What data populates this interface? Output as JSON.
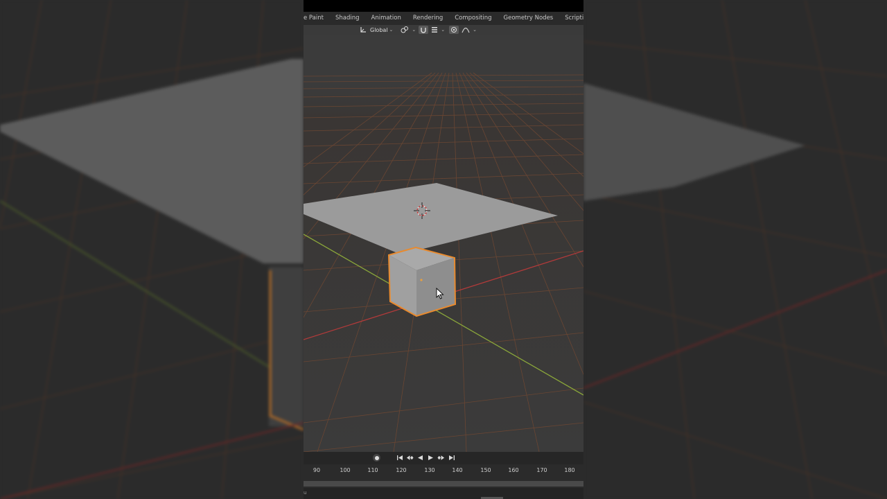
{
  "workspace_tabs": [
    {
      "label": "e Paint"
    },
    {
      "label": "Shading"
    },
    {
      "label": "Animation"
    },
    {
      "label": "Rendering"
    },
    {
      "label": "Compositing"
    },
    {
      "label": "Geometry Nodes"
    },
    {
      "label": "Scripting"
    }
  ],
  "add_tab_label": "+",
  "header": {
    "transform_orientation": "Global",
    "chevron": "⌄"
  },
  "timeline": {
    "ticks": [
      "90",
      "100",
      "110",
      "120",
      "130",
      "140",
      "150",
      "160",
      "170",
      "180"
    ],
    "bottom_text": "u"
  },
  "colors": {
    "selection_outline": "#e88a2e",
    "grid_line": "#6e4a32",
    "x_axis": "#b23a3a",
    "y_axis": "#7fa12f",
    "plane": "#9a9a9a",
    "cube_front": "#8e8e8e"
  }
}
